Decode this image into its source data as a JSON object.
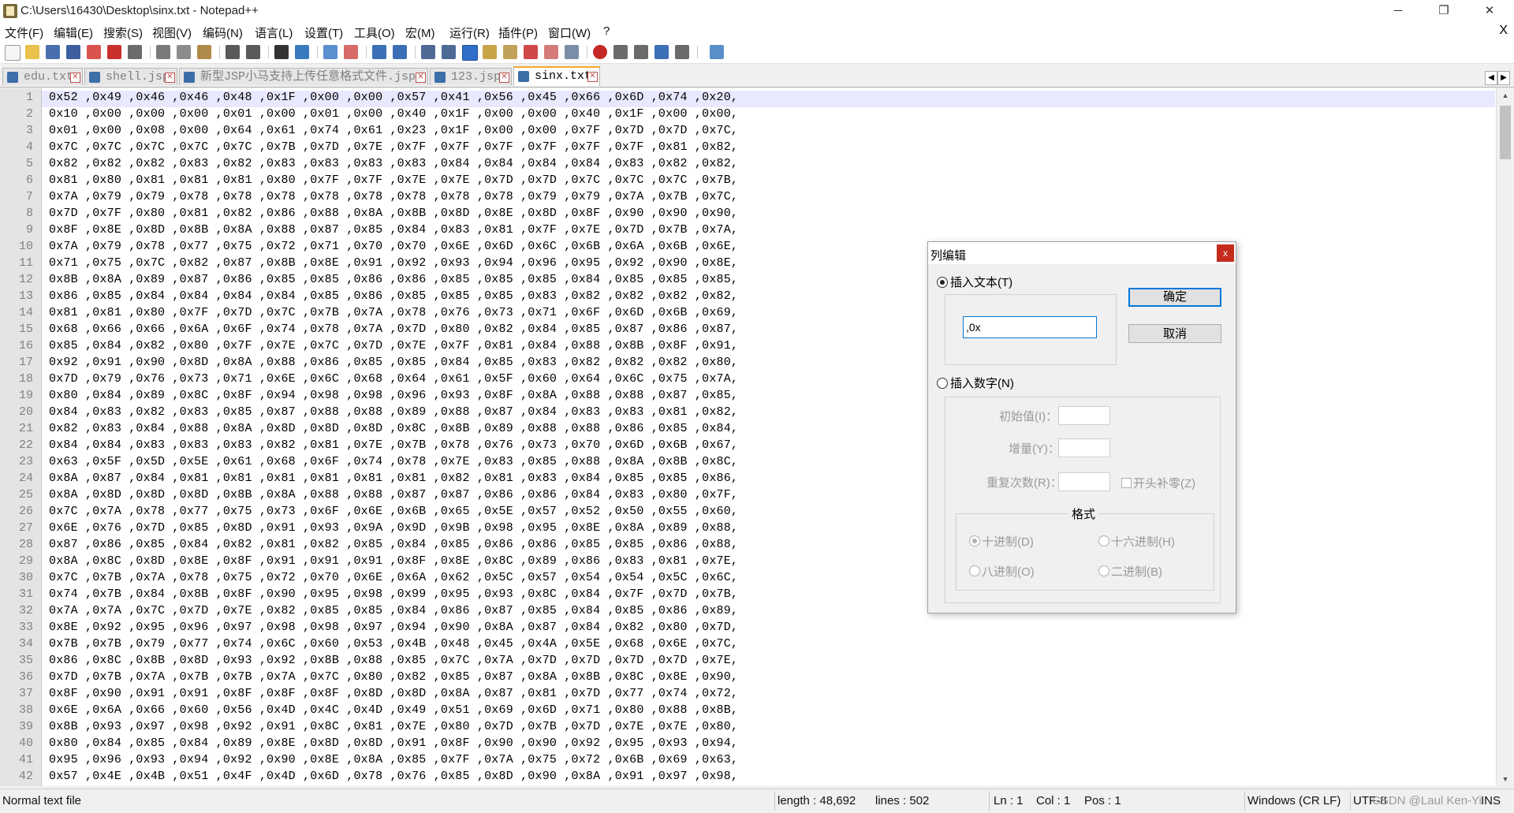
{
  "window": {
    "title": "C:\\Users\\16430\\Desktop\\sinx.txt - Notepad++"
  },
  "menu": [
    "文件(F)",
    "编辑(E)",
    "搜索(S)",
    "视图(V)",
    "编码(N)",
    "语言(L)",
    "设置(T)",
    "工具(O)",
    "宏(M)",
    "运行(R)",
    "插件(P)",
    "窗口(W)",
    "?"
  ],
  "menu_close": "X",
  "tabs": [
    {
      "label": "edu.txt",
      "active": false
    },
    {
      "label": "shell.jsp",
      "active": false
    },
    {
      "label": "新型JSP小马支持上传任意格式文件.jsp",
      "active": false
    },
    {
      "label": "123.jsp",
      "active": false
    },
    {
      "label": "sinx.txt",
      "active": true
    }
  ],
  "editor": {
    "line_numbers": [
      "1",
      "2",
      "3",
      "4",
      "5",
      "6",
      "7",
      "8",
      "9",
      "10",
      "11",
      "12",
      "13",
      "14",
      "15",
      "16",
      "17",
      "18",
      "19",
      "20",
      "21",
      "22",
      "23",
      "24",
      "25",
      "26",
      "27",
      "28",
      "29",
      "30",
      "31",
      "32",
      "33",
      "34",
      "35",
      "36",
      "37",
      "38",
      "39",
      "40",
      "41",
      "42"
    ],
    "lines": [
      "0x52 ,0x49 ,0x46 ,0x46 ,0x48 ,0x1F ,0x00 ,0x00 ,0x57 ,0x41 ,0x56 ,0x45 ,0x66 ,0x6D ,0x74 ,0x20,",
      "0x10 ,0x00 ,0x00 ,0x00 ,0x01 ,0x00 ,0x01 ,0x00 ,0x40 ,0x1F ,0x00 ,0x00 ,0x40 ,0x1F ,0x00 ,0x00,",
      "0x01 ,0x00 ,0x08 ,0x00 ,0x64 ,0x61 ,0x74 ,0x61 ,0x23 ,0x1F ,0x00 ,0x00 ,0x7F ,0x7D ,0x7D ,0x7C,",
      "0x7C ,0x7C ,0x7C ,0x7C ,0x7C ,0x7B ,0x7D ,0x7E ,0x7F ,0x7F ,0x7F ,0x7F ,0x7F ,0x7F ,0x81 ,0x82,",
      "0x82 ,0x82 ,0x82 ,0x83 ,0x82 ,0x83 ,0x83 ,0x83 ,0x83 ,0x84 ,0x84 ,0x84 ,0x84 ,0x83 ,0x82 ,0x82,",
      "0x81 ,0x80 ,0x81 ,0x81 ,0x81 ,0x80 ,0x7F ,0x7F ,0x7E ,0x7E ,0x7D ,0x7D ,0x7C ,0x7C ,0x7C ,0x7B,",
      "0x7A ,0x79 ,0x79 ,0x78 ,0x78 ,0x78 ,0x78 ,0x78 ,0x78 ,0x78 ,0x78 ,0x79 ,0x79 ,0x7A ,0x7B ,0x7C,",
      "0x7D ,0x7F ,0x80 ,0x81 ,0x82 ,0x86 ,0x88 ,0x8A ,0x8B ,0x8D ,0x8E ,0x8D ,0x8F ,0x90 ,0x90 ,0x90,",
      "0x8F ,0x8E ,0x8D ,0x8B ,0x8A ,0x88 ,0x87 ,0x85 ,0x84 ,0x83 ,0x81 ,0x7F ,0x7E ,0x7D ,0x7B ,0x7A,",
      "0x7A ,0x79 ,0x78 ,0x77 ,0x75 ,0x72 ,0x71 ,0x70 ,0x70 ,0x6E ,0x6D ,0x6C ,0x6B ,0x6A ,0x6B ,0x6E,",
      "0x71 ,0x75 ,0x7C ,0x82 ,0x87 ,0x8B ,0x8E ,0x91 ,0x92 ,0x93 ,0x94 ,0x96 ,0x95 ,0x92 ,0x90 ,0x8E,",
      "0x8B ,0x8A ,0x89 ,0x87 ,0x86 ,0x85 ,0x85 ,0x86 ,0x86 ,0x85 ,0x85 ,0x85 ,0x84 ,0x85 ,0x85 ,0x85,",
      "0x86 ,0x85 ,0x84 ,0x84 ,0x84 ,0x84 ,0x85 ,0x86 ,0x85 ,0x85 ,0x85 ,0x83 ,0x82 ,0x82 ,0x82 ,0x82,",
      "0x81 ,0x81 ,0x80 ,0x7F ,0x7D ,0x7C ,0x7B ,0x7A ,0x78 ,0x76 ,0x73 ,0x71 ,0x6F ,0x6D ,0x6B ,0x69,",
      "0x68 ,0x66 ,0x66 ,0x6A ,0x6F ,0x74 ,0x78 ,0x7A ,0x7D ,0x80 ,0x82 ,0x84 ,0x85 ,0x87 ,0x86 ,0x87,",
      "0x85 ,0x84 ,0x82 ,0x80 ,0x7F ,0x7E ,0x7C ,0x7D ,0x7E ,0x7F ,0x81 ,0x84 ,0x88 ,0x8B ,0x8F ,0x91,",
      "0x92 ,0x91 ,0x90 ,0x8D ,0x8A ,0x88 ,0x86 ,0x85 ,0x85 ,0x84 ,0x85 ,0x83 ,0x82 ,0x82 ,0x82 ,0x80,",
      "0x7D ,0x79 ,0x76 ,0x73 ,0x71 ,0x6E ,0x6C ,0x68 ,0x64 ,0x61 ,0x5F ,0x60 ,0x64 ,0x6C ,0x75 ,0x7A,",
      "0x80 ,0x84 ,0x89 ,0x8C ,0x8F ,0x94 ,0x98 ,0x98 ,0x96 ,0x93 ,0x8F ,0x8A ,0x88 ,0x88 ,0x87 ,0x85,",
      "0x84 ,0x83 ,0x82 ,0x83 ,0x85 ,0x87 ,0x88 ,0x88 ,0x89 ,0x88 ,0x87 ,0x84 ,0x83 ,0x83 ,0x81 ,0x82,",
      "0x82 ,0x83 ,0x84 ,0x88 ,0x8A ,0x8D ,0x8D ,0x8D ,0x8C ,0x8B ,0x89 ,0x88 ,0x88 ,0x86 ,0x85 ,0x84,",
      "0x84 ,0x84 ,0x83 ,0x83 ,0x83 ,0x82 ,0x81 ,0x7E ,0x7B ,0x78 ,0x76 ,0x73 ,0x70 ,0x6D ,0x6B ,0x67,",
      "0x63 ,0x5F ,0x5D ,0x5E ,0x61 ,0x68 ,0x6F ,0x74 ,0x78 ,0x7E ,0x83 ,0x85 ,0x88 ,0x8A ,0x8B ,0x8C,",
      "0x8A ,0x87 ,0x84 ,0x81 ,0x81 ,0x81 ,0x81 ,0x81 ,0x81 ,0x82 ,0x81 ,0x83 ,0x84 ,0x85 ,0x85 ,0x86,",
      "0x8A ,0x8D ,0x8D ,0x8D ,0x8B ,0x8A ,0x88 ,0x88 ,0x87 ,0x87 ,0x86 ,0x86 ,0x84 ,0x83 ,0x80 ,0x7F,",
      "0x7C ,0x7A ,0x78 ,0x77 ,0x75 ,0x73 ,0x6F ,0x6E ,0x6B ,0x65 ,0x5E ,0x57 ,0x52 ,0x50 ,0x55 ,0x60,",
      "0x6E ,0x76 ,0x7D ,0x85 ,0x8D ,0x91 ,0x93 ,0x9A ,0x9D ,0x9B ,0x98 ,0x95 ,0x8E ,0x8A ,0x89 ,0x88,",
      "0x87 ,0x86 ,0x85 ,0x84 ,0x82 ,0x81 ,0x82 ,0x85 ,0x84 ,0x85 ,0x86 ,0x86 ,0x85 ,0x85 ,0x86 ,0x88,",
      "0x8A ,0x8C ,0x8D ,0x8E ,0x8F ,0x91 ,0x91 ,0x91 ,0x8F ,0x8E ,0x8C ,0x89 ,0x86 ,0x83 ,0x81 ,0x7E,",
      "0x7C ,0x7B ,0x7A ,0x78 ,0x75 ,0x72 ,0x70 ,0x6E ,0x6A ,0x62 ,0x5C ,0x57 ,0x54 ,0x54 ,0x5C ,0x6C,",
      "0x74 ,0x7B ,0x84 ,0x8B ,0x8F ,0x90 ,0x95 ,0x98 ,0x99 ,0x95 ,0x93 ,0x8C ,0x84 ,0x7F ,0x7D ,0x7B,",
      "0x7A ,0x7A ,0x7C ,0x7D ,0x7E ,0x82 ,0x85 ,0x85 ,0x84 ,0x86 ,0x87 ,0x85 ,0x84 ,0x85 ,0x86 ,0x89,",
      "0x8E ,0x92 ,0x95 ,0x96 ,0x97 ,0x98 ,0x98 ,0x97 ,0x94 ,0x90 ,0x8A ,0x87 ,0x84 ,0x82 ,0x80 ,0x7D,",
      "0x7B ,0x7B ,0x79 ,0x77 ,0x74 ,0x6C ,0x60 ,0x53 ,0x4B ,0x48 ,0x45 ,0x4A ,0x5E ,0x68 ,0x6E ,0x7C,",
      "0x86 ,0x8C ,0x8B ,0x8D ,0x93 ,0x92 ,0x8B ,0x88 ,0x85 ,0x7C ,0x7A ,0x7D ,0x7D ,0x7D ,0x7D ,0x7E,",
      "0x7D ,0x7B ,0x7A ,0x7B ,0x7B ,0x7A ,0x7C ,0x80 ,0x82 ,0x85 ,0x87 ,0x8A ,0x8B ,0x8C ,0x8E ,0x90,",
      "0x8F ,0x90 ,0x91 ,0x91 ,0x8F ,0x8F ,0x8F ,0x8D ,0x8D ,0x8A ,0x87 ,0x81 ,0x7D ,0x77 ,0x74 ,0x72,",
      "0x6E ,0x6A ,0x66 ,0x60 ,0x56 ,0x4D ,0x4C ,0x4D ,0x49 ,0x51 ,0x69 ,0x6D ,0x71 ,0x80 ,0x88 ,0x8B,",
      "0x8B ,0x93 ,0x97 ,0x98 ,0x92 ,0x91 ,0x8C ,0x81 ,0x7E ,0x80 ,0x7D ,0x7B ,0x7D ,0x7E ,0x7E ,0x80,",
      "0x80 ,0x84 ,0x85 ,0x84 ,0x89 ,0x8E ,0x8D ,0x8D ,0x91 ,0x8F ,0x90 ,0x90 ,0x92 ,0x95 ,0x93 ,0x94,",
      "0x95 ,0x96 ,0x93 ,0x94 ,0x92 ,0x90 ,0x8E ,0x8A ,0x85 ,0x7F ,0x7A ,0x75 ,0x72 ,0x6B ,0x69 ,0x63,",
      "0x57 ,0x4E ,0x4B ,0x51 ,0x4F ,0x4D ,0x6D ,0x78 ,0x76 ,0x85 ,0x8D ,0x90 ,0x8A ,0x91 ,0x97 ,0x98,"
    ]
  },
  "status": {
    "file_type": "Normal text file",
    "length": "length : 48,692",
    "lines": "lines : 502",
    "ln": "Ln : 1",
    "col": "Col : 1",
    "pos": "Pos : 1",
    "eol": "Windows (CR LF)",
    "encoding": "UTF-8",
    "mode": "INS",
    "watermark": "CSDN @Laul Ken-Yi"
  },
  "dialog": {
    "title": "列编辑",
    "close": "x",
    "insert_text_label": "插入文本(T)",
    "insert_text_value": ",0x",
    "ok_label": "确定",
    "cancel_label": "取消",
    "insert_number_label": "插入数字(N)",
    "initial_label": "初始值(I)：",
    "increment_label": "增量(Y)：",
    "repeat_label": "重复次数(R)：",
    "leading_zero_label": "开头补零(Z)",
    "format_label": "格式",
    "decimal_label": "十进制(D)",
    "hex_label": "十六进制(H)",
    "octal_label": "八进制(O)",
    "binary_label": "二进制(B)"
  }
}
